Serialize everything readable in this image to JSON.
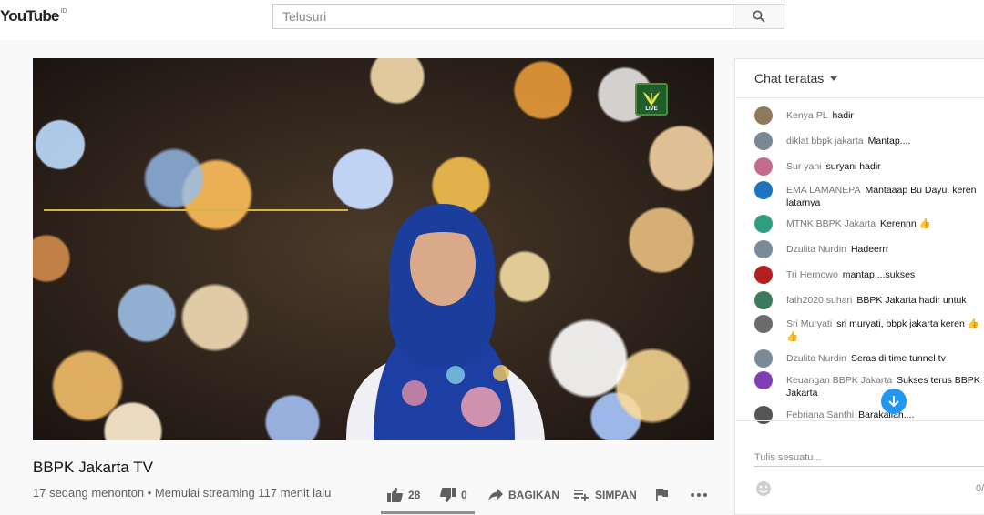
{
  "header": {
    "logo_text": "YouTube",
    "logo_region": "ID",
    "search_placeholder": "Telusuri"
  },
  "video": {
    "badge_text": "LIVE",
    "title": "BBPK Jakarta TV",
    "view_info": "17 sedang menonton • Memulai streaming 117 menit lalu"
  },
  "actions": {
    "likes": "28",
    "dislikes": "0",
    "share": "BAGIKAN",
    "save": "SIMPAN"
  },
  "chat": {
    "header": "Chat teratas",
    "input_placeholder": "Tulis sesuatu...",
    "char_count": "0/",
    "messages": [
      {
        "author": "Kenya PL",
        "text": "hadir",
        "avatar_color": "#8d7a5a"
      },
      {
        "author": "diklat bbpk jakarta",
        "text": "Mantap....",
        "avatar_color": "#7a8896"
      },
      {
        "author": "Sur yani",
        "text": "suryani hadir",
        "avatar_color": "#c46a8a"
      },
      {
        "author": "EMA LAMANEPA",
        "text": "Mantaaap Bu Dayu. keren latarnya",
        "avatar_color": "#1e73be"
      },
      {
        "author": "MTNK BBPK Jakarta",
        "text": "Kerennn 👍",
        "avatar_color": "#2e9e7e"
      },
      {
        "author": "Dzulita Nurdin",
        "text": "Hadeerrr",
        "avatar_color": "#7b8a99"
      },
      {
        "author": "Tri Hernowo",
        "text": "mantap....sukses",
        "avatar_color": "#b22020"
      },
      {
        "author": "fath2020 suhari",
        "text": "BBPK Jakarta hadir untuk",
        "avatar_color": "#3c7a5a"
      },
      {
        "author": "Sri Muryati",
        "text": "sri muryati, bbpk jakarta keren 👍👍",
        "avatar_color": "#6b6b6b"
      },
      {
        "author": "Dzulita Nurdin",
        "text": "Seras di time tunnel tv",
        "avatar_color": "#7b8a99"
      },
      {
        "author": "Keuangan BBPK Jakarta",
        "text": "Sukses terus BBPK Jakarta",
        "avatar_color": "#7e3fb5"
      },
      {
        "author": "Febriana Santhi",
        "text": "Barakallah....",
        "avatar_color": "#555555"
      }
    ]
  },
  "colors": {
    "accent_blue": "#2196f3",
    "badge_green": "#1f5e2a"
  }
}
